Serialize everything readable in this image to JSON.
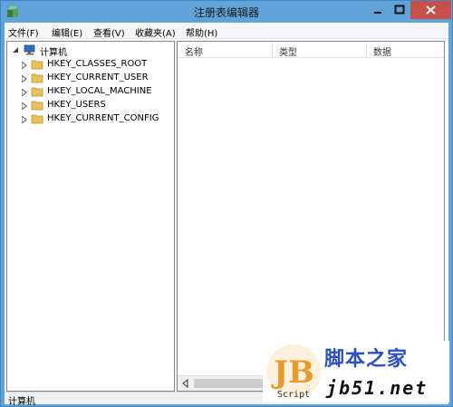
{
  "window": {
    "title": "注册表编辑器",
    "icon": "registry-editor-icon"
  },
  "menu": {
    "items": [
      {
        "label": "文件(F)"
      },
      {
        "label": "编辑(E)"
      },
      {
        "label": "查看(V)"
      },
      {
        "label": "收藏夹(A)"
      },
      {
        "label": "帮助(H)"
      }
    ]
  },
  "tree": {
    "root": {
      "label": "计算机",
      "icon": "computer-icon",
      "expanded": true
    },
    "keys": [
      {
        "label": "HKEY_CLASSES_ROOT"
      },
      {
        "label": "HKEY_CURRENT_USER"
      },
      {
        "label": "HKEY_LOCAL_MACHINE"
      },
      {
        "label": "HKEY_USERS"
      },
      {
        "label": "HKEY_CURRENT_CONFIG"
      }
    ]
  },
  "list": {
    "columns": [
      {
        "label": "名称"
      },
      {
        "label": "类型"
      },
      {
        "label": "数据"
      }
    ]
  },
  "statusbar": {
    "text": "计算机"
  },
  "watermark": {
    "logo_letters": "JB",
    "logo_caption": "Script",
    "site_name": "脚本之家",
    "site_url": "jb51.net"
  },
  "colors": {
    "titlebar": "#5fa3d8",
    "close_button": "#c7504b",
    "folder": "#e8c15a",
    "watermark_blue": "#2a4fc0",
    "watermark_orange": "#e89a2c"
  }
}
